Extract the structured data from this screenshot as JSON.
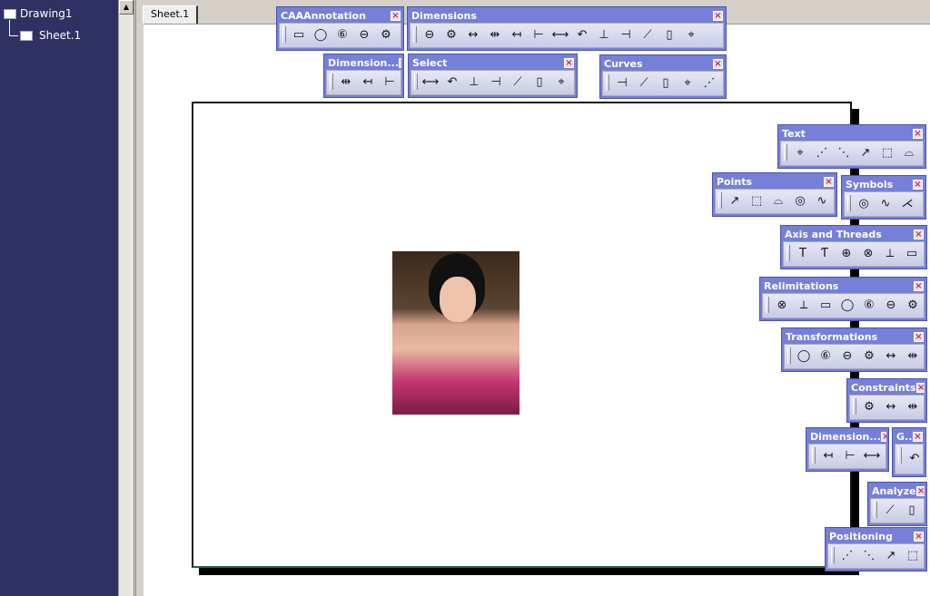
{
  "tree": {
    "root": "Drawing1",
    "child": "Sheet.1"
  },
  "tab": "Sheet.1",
  "toolbars": [
    {
      "title": "CAAAnnotation",
      "icons": [
        "text-ab-icon",
        "circle-a-icon",
        "balloon-6-icon",
        "datum-icon",
        "gear-check-icon"
      ]
    },
    {
      "title": "Dimensions",
      "icons": [
        "dim-1-icon",
        "dim-2-icon",
        "dim-3-icon",
        "dim-4-icon",
        "length-dim-icon",
        "angle-dim-icon",
        "radius-dim-icon",
        "diameter-dim-icon",
        "chamfer-dim-icon",
        "thread-dim-icon",
        "coordinate-dim-icon",
        "hole-table-icon",
        "point-table-icon"
      ]
    },
    {
      "title": "Dimension...",
      "icons": [
        "interrupt-icon",
        "add-dim-icon",
        "remove-dim-icon"
      ]
    },
    {
      "title": "Select",
      "icons": [
        "select-arrow-icon",
        "select-box-icon",
        "select-trap-icon",
        "select-circle-icon",
        "lasso-icon",
        "select-intersect-icon",
        "select-outside-icon"
      ]
    },
    {
      "title": "Curves",
      "icons": [
        "arc-icon",
        "three-point-arc-icon",
        "spline-icon",
        "connect-curve-icon",
        "corner-icon"
      ]
    },
    {
      "title": "Text",
      "icons": [
        "text-icon",
        "text-leader-icon",
        "text-replicate-icon",
        "balloon-icon",
        "datum-feature-icon",
        "table-icon"
      ]
    },
    {
      "title": "Points",
      "icons": [
        "point-icon",
        "point-coord-icon",
        "equidistant-points-icon",
        "intersection-point-icon",
        "projection-icon"
      ]
    },
    {
      "title": "Symbols",
      "icons": [
        "roughness-icon",
        "welding-icon",
        "weld-icon"
      ]
    },
    {
      "title": "Axis and Threads",
      "icons": [
        "center-line-icon",
        "center-line-ref-icon",
        "thread-icon",
        "thread-ref-icon",
        "axis-line-icon",
        "axis-2pt-icon"
      ]
    },
    {
      "title": "Relimitations",
      "icons": [
        "corner-fillet-icon",
        "chamfer-icon",
        "trim-icon",
        "break-icon",
        "quick-trim-icon",
        "close-icon",
        "complement-icon"
      ]
    },
    {
      "title": "Transformations",
      "icons": [
        "mirror-icon",
        "symmetry-icon",
        "translate-icon",
        "rotate-icon",
        "scale-icon",
        "offset-icon"
      ]
    },
    {
      "title": "Constraints",
      "icons": [
        "constraint-icon",
        "contact-icon",
        "fix-icon"
      ]
    },
    {
      "title": "Dimension...",
      "icons": [
        "dim-gen-1-icon",
        "dim-gen-2-icon",
        "dim-gen-3-icon"
      ]
    },
    {
      "title": "G..",
      "icons": [
        "generate-icon"
      ]
    },
    {
      "title": "Analyze",
      "icons": [
        "analyze-1-icon",
        "analyze-2-icon"
      ]
    },
    {
      "title": "Positioning",
      "icons": [
        "align-icon",
        "position-1-icon",
        "position-2-icon",
        "position-3-icon"
      ]
    }
  ]
}
